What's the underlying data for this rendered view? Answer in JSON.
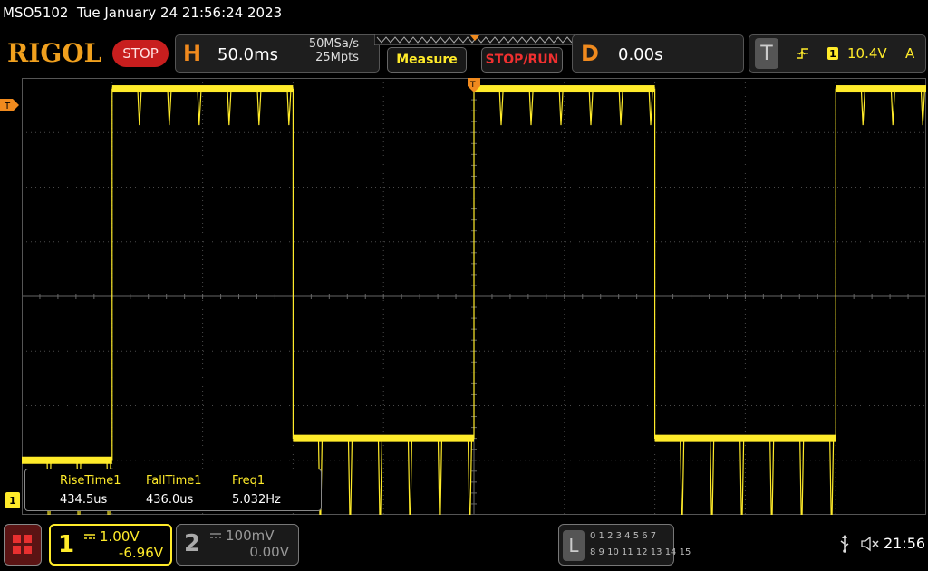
{
  "status": {
    "model": "MSO5102",
    "datetime": "Tue January 24 21:56:24 2023"
  },
  "toolbar": {
    "logo": "RIGOL",
    "run_state": "STOP",
    "horizontal": {
      "letter": "H",
      "timebase": "50.0ms",
      "sample_rate": "50MSa/s",
      "memory_depth": "25Mpts"
    },
    "measure_label": "Measure",
    "stop_run_label": "STOP/RUN",
    "delay": {
      "letter": "D",
      "value": "0.00s"
    },
    "trigger": {
      "letter": "T",
      "channel": "1",
      "level": "10.4V",
      "mode": "A",
      "slope_icon": "rising-edge-icon"
    }
  },
  "markers": {
    "trigger_level": "T",
    "channel1": "1"
  },
  "measurements": [
    {
      "label": "RiseTime1",
      "value": "434.5us"
    },
    {
      "label": "FallTime1",
      "value": "436.0us"
    },
    {
      "label": "Freq1",
      "value": "5.032Hz"
    }
  ],
  "channels": [
    {
      "number": "1",
      "scale": "1.00V",
      "offset": "-6.96V",
      "active": true
    },
    {
      "number": "2",
      "scale": "100mV",
      "offset": "0.00V",
      "active": false
    }
  ],
  "logic_analyzer": {
    "letter": "L",
    "row1": "0 1 2 3  4 5 6 7",
    "row2": "8 9 10 11 12 13 14 15"
  },
  "system": {
    "time": "21:56"
  },
  "colors": {
    "accent": "#f08a1e",
    "channel1": "#ffeb2a",
    "stop": "#c81e1e",
    "grid": "#4a4a4a"
  },
  "chart_data": {
    "type": "line",
    "title": "",
    "xlabel": "",
    "ylabel": "",
    "grid": true,
    "x_divisions": 10,
    "y_divisions": 8,
    "series": [
      {
        "name": "",
        "color": "#ffeb2a",
        "description": "square wave with high-frequency ripple",
        "x": [
          0,
          1.0,
          1.0,
          3.0,
          3.0,
          5.0,
          5.0,
          7.0,
          7.0,
          9.0,
          9.0,
          10
        ],
        "y": [
          -3.0,
          -3.0,
          3.8,
          3.8,
          -2.6,
          -2.6,
          3.8,
          3.8,
          -2.6,
          -2.6,
          3.8,
          3.8
        ]
      }
    ]
  }
}
